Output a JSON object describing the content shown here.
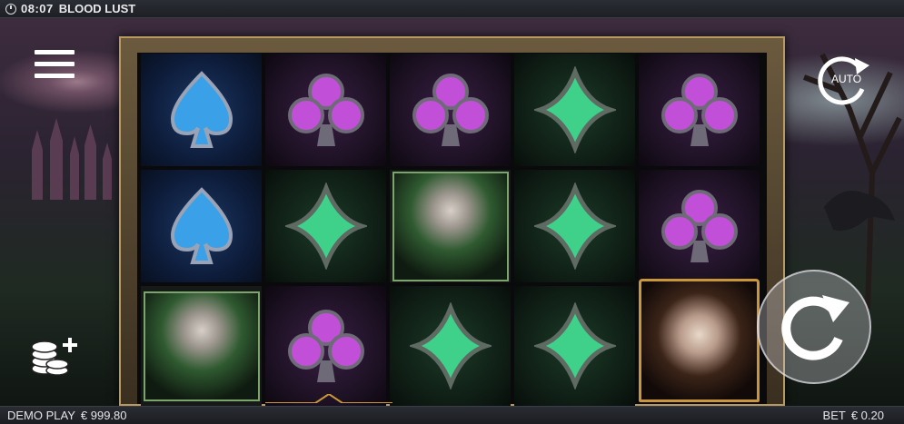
{
  "topbar": {
    "time": "08:07",
    "title": "BLOOD LUST",
    "icon": "clock-icon"
  },
  "controls": {
    "menu_icon": "hamburger-menu-icon",
    "auto_label": "AUTO",
    "auto_icon": "autoplay-arrow-icon",
    "coins_icon": "coin-stack-plus-icon",
    "spin_icon": "spin-arrow-icon"
  },
  "reels": [
    [
      "spade",
      "spade",
      "green-haired-vampire"
    ],
    [
      "club",
      "diamond",
      "club"
    ],
    [
      "club",
      "green-haired-vampire",
      "diamond"
    ],
    [
      "diamond",
      "diamond",
      "diamond"
    ],
    [
      "club",
      "club",
      "golden-vampire-wild"
    ]
  ],
  "bottombar": {
    "mode_label": "DEMO PLAY",
    "balance": "€ 999.80",
    "bet_label": "BET",
    "bet_value": "€ 0.20"
  },
  "colors": {
    "frame_gold": "#b89a60",
    "club_purple": "#c24fd8",
    "diamond_green": "#3fd08a",
    "spade_blue": "#5ab8ff"
  }
}
